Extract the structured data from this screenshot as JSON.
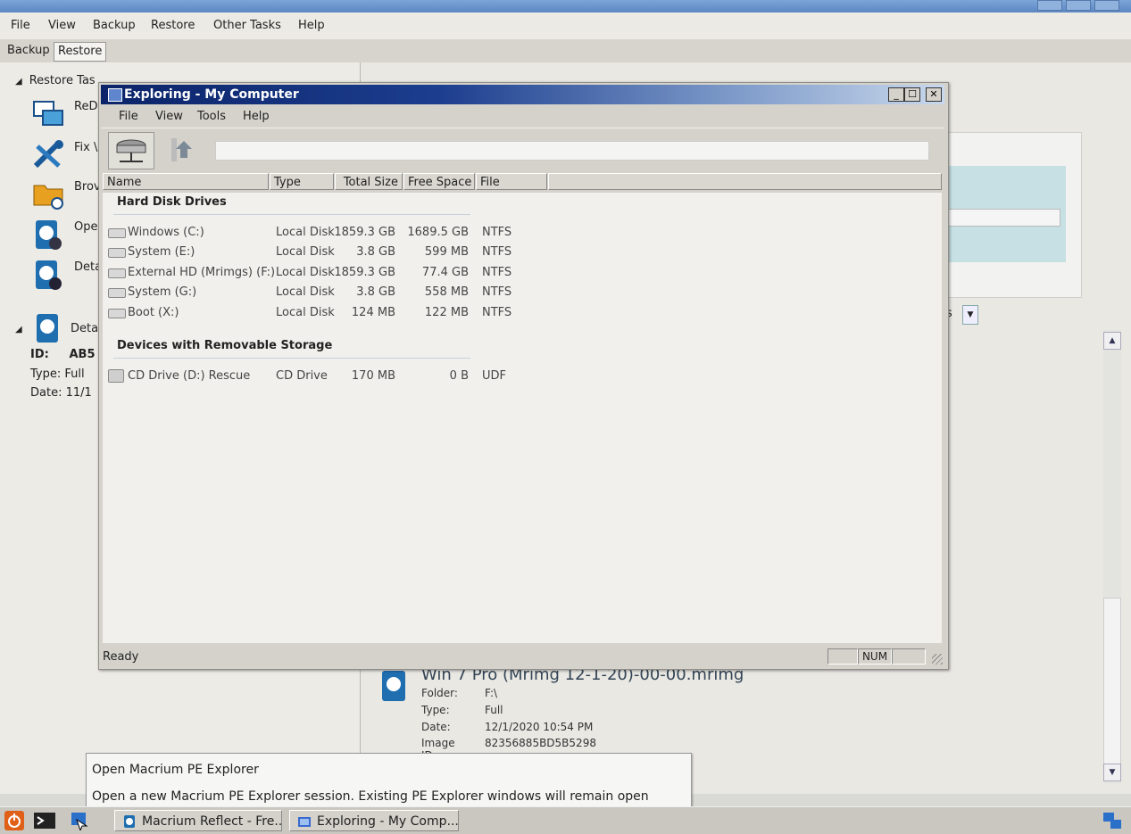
{
  "main_menu": [
    "File",
    "View",
    "Backup",
    "Restore",
    "Other Tasks",
    "Help"
  ],
  "main_tabs": [
    "Backup",
    "Restore"
  ],
  "restore_tasks": {
    "header": "Restore Tas",
    "items": [
      "ReD",
      "Fix \\",
      "Brov",
      "Ope",
      "Deta"
    ]
  },
  "details": {
    "header": "Detai",
    "id_label": "ID:",
    "id_value": "AB5",
    "type_label": "Type:",
    "type_value": "Full",
    "date_label": "Date:",
    "date_value": "11/1"
  },
  "right_dropdown_text": "s",
  "image_info": {
    "title": "Win 7 Pro (Mrimg 12-1-20)-00-00.mrimg",
    "folder_label": "Folder:",
    "folder_value": "F:\\",
    "type_label": "Type:",
    "type_value": "Full",
    "date_label": "Date:",
    "date_value": "12/1/2020 10:54 PM",
    "imageid_label": "Image ID:",
    "imageid_value": "82356885BD5B5298"
  },
  "explorer": {
    "title": "Exploring - My Computer",
    "menu": [
      "File",
      "View",
      "Tools",
      "Help"
    ],
    "address": "",
    "columns": [
      "Name",
      "Type",
      "Total Size",
      "Free Space",
      "File System"
    ],
    "groups": [
      {
        "name": "Hard Disk Drives",
        "rows": [
          {
            "name": "Windows (C:)",
            "type": "Local Disk",
            "total": "1859.3 GB",
            "free": "1689.5 GB",
            "fs": "NTFS",
            "icon": "hard-disk-icon"
          },
          {
            "name": "System (E:)",
            "type": "Local Disk",
            "total": "3.8 GB",
            "free": "599 MB",
            "fs": "NTFS",
            "icon": "hard-disk-icon"
          },
          {
            "name": "External HD (Mrimgs)  (F:)",
            "type": "Local Disk",
            "total": "1859.3 GB",
            "free": "77.4 GB",
            "fs": "NTFS",
            "icon": "hard-disk-icon"
          },
          {
            "name": "System (G:)",
            "type": "Local Disk",
            "total": "3.8 GB",
            "free": "558 MB",
            "fs": "NTFS",
            "icon": "hard-disk-icon"
          },
          {
            "name": "Boot (X:)",
            "type": "Local Disk",
            "total": "124 MB",
            "free": "122 MB",
            "fs": "NTFS",
            "icon": "hard-disk-icon"
          }
        ]
      },
      {
        "name": "Devices with Removable Storage",
        "rows": [
          {
            "name": "CD Drive (D:) Rescue",
            "type": "CD Drive",
            "total": "170 MB",
            "free": "0 B",
            "fs": "UDF",
            "icon": "cd-drive-icon"
          }
        ]
      }
    ],
    "status": "Ready",
    "status_num": "NUM"
  },
  "tooltip": {
    "title": "Open Macrium PE Explorer",
    "description": "Open a new Macrium PE Explorer session. Existing PE Explorer windows will remain open"
  },
  "taskbar": {
    "buttons": [
      "Macrium Reflect - Fre...",
      "Exploring - My Comp..."
    ],
    "icons": [
      "power-icon",
      "terminal-icon",
      "pe-explorer-icon",
      "network-tray-icon"
    ]
  },
  "colors": {
    "explorer_title_start": "#0b2469",
    "explorer_title_end": "#c9d8ec",
    "window_face": "#d4d2cb",
    "accent_teal": "#c6e0e4"
  }
}
